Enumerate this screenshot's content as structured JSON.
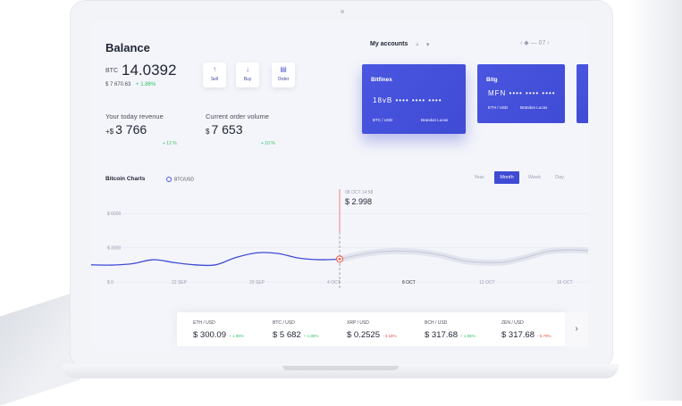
{
  "balance": {
    "title": "Balance",
    "btc_code": "BTC",
    "btc_value": "14.0392",
    "usd_value": "$ 7 670.63",
    "usd_change": "+ 1.86%"
  },
  "actions": [
    {
      "label": "Sell",
      "icon": "↑",
      "icon_name": "arrow-up-icon"
    },
    {
      "label": "Buy",
      "icon": "↓",
      "icon_name": "arrow-down-icon"
    },
    {
      "label": "Order",
      "icon": "▤",
      "icon_name": "document-icon"
    }
  ],
  "stats": {
    "revenue_label": "Your  today revenue",
    "revenue_prefix": "+$",
    "revenue_value": "3 766",
    "revenue_change": "+ 12 %",
    "volume_label": "Current order volume",
    "volume_prefix": "$",
    "volume_value": "7 653",
    "volume_change": "+ 10 %"
  },
  "accounts": {
    "title": "My accounts",
    "search_icon": "⌕",
    "filter_icon": "▾",
    "pager": "‹  ◆ — 07  ›",
    "cards": [
      {
        "name": "Bitfinex",
        "number": "18vB  •••• •••• ••••",
        "currency": "BTC / USD",
        "holder": "Brandon Lucas"
      },
      {
        "name": "Bitg",
        "number": "MFN  •••• •••• ••••",
        "currency": "ETH / USD",
        "holder": "Brandon Lucas"
      }
    ]
  },
  "chart": {
    "title": "Bitcoin Charts",
    "pair": "BTC/USD",
    "periods": [
      "Year",
      "Month",
      "Week",
      "Day"
    ],
    "active_period": "Month",
    "tooltip_date": "08 OCT 14:58",
    "tooltip_value": "$ 2.998",
    "accent_color": "#3f4bd4",
    "marker_color": "#e86a5c"
  },
  "chart_data": {
    "type": "line",
    "ylabels": [
      "$ 6000",
      "$ 3000",
      "$ 0"
    ],
    "xlabels": [
      "22 SEP",
      "29 SEP",
      "4 OCT",
      "8 OCT",
      "12 OCT",
      "16 OCT"
    ],
    "series": [
      {
        "values": [
          1500,
          1480,
          1600,
          1950,
          1700,
          1500,
          1500,
          2150,
          2550,
          2500,
          2100,
          1950,
          2000,
          2400,
          2650,
          2700,
          2600,
          2300,
          1850,
          1700,
          1750,
          2150,
          2650,
          2800,
          2750
        ]
      }
    ],
    "ylim": [
      0,
      7500
    ],
    "highlight_index": 12
  },
  "tickers": [
    {
      "pair": "ETH / USD",
      "value": "$ 300.09",
      "change": "+ 1.86%",
      "positive": true
    },
    {
      "pair": "BTC / USD",
      "value": "$ 5 682",
      "change": "+ 1.86%",
      "positive": true
    },
    {
      "pair": "XRP / USD",
      "value": "$ 0.2525",
      "change": "- 3.18%",
      "positive": false
    },
    {
      "pair": "BCH / USD",
      "value": "$ 317.68",
      "change": "+ 1.86%",
      "positive": true
    },
    {
      "pair": "ZEN / USD",
      "value": "$ 317.68",
      "change": "- 6.79%",
      "positive": false
    }
  ],
  "next_icon": "›"
}
